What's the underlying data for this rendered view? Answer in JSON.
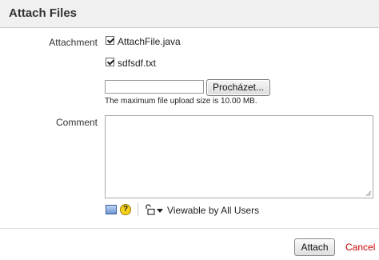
{
  "dialog": {
    "title": "Attach Files"
  },
  "attachment": {
    "label": "Attachment",
    "files": [
      {
        "name": "AttachFile.java",
        "checked": true
      },
      {
        "name": "sdfsdf.txt",
        "checked": true
      }
    ],
    "file_input_value": "",
    "browse_label": "Procházet...",
    "max_size_hint": "The maximum file upload size is 10.00 MB."
  },
  "comment": {
    "label": "Comment",
    "value": ""
  },
  "toolbar": {
    "wiki_icon": "wiki-markup-icon",
    "help_icon": "help-icon",
    "help_glyph": "?",
    "lock_icon": "unlock-icon",
    "visibility_label": "Viewable by All Users"
  },
  "footer": {
    "attach_label": "Attach",
    "cancel_label": "Cancel"
  },
  "colors": {
    "cancel": "#cc0000",
    "header_bg": "#f0f0f0"
  }
}
